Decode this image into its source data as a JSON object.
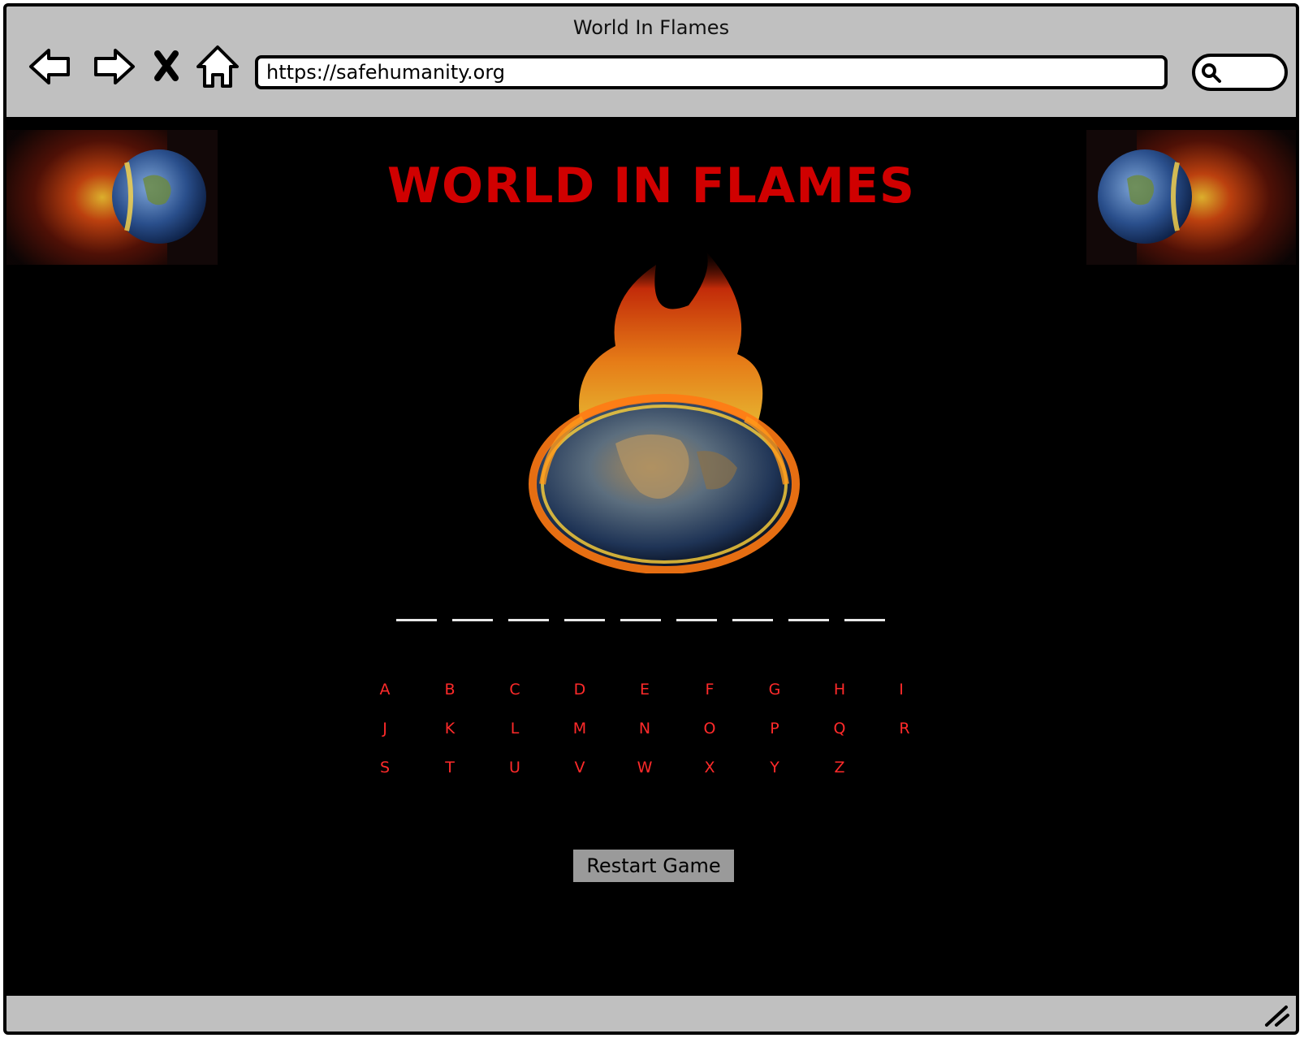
{
  "window": {
    "title": "World In Flames"
  },
  "toolbar": {
    "back_icon": "arrow-left-icon",
    "forward_icon": "arrow-right-icon",
    "stop_icon": "close-icon",
    "home_icon": "home-icon",
    "url": "https://safehumanity.org",
    "search_icon": "search-icon"
  },
  "page": {
    "title": "WORLD IN FLAMES",
    "title_color": "#d00000",
    "word_blank_count": 9,
    "letters": [
      "A",
      "B",
      "C",
      "D",
      "E",
      "F",
      "G",
      "H",
      "I",
      "J",
      "K",
      "L",
      "M",
      "N",
      "O",
      "P",
      "Q",
      "R",
      "S",
      "T",
      "U",
      "V",
      "W",
      "X",
      "Y",
      "Z"
    ],
    "letter_color": "#ff2a2a",
    "restart_label": "Restart Game",
    "background_color": "#000000"
  },
  "colors": {
    "chrome": "#c0c0c0",
    "button": "#9a9a9a"
  }
}
